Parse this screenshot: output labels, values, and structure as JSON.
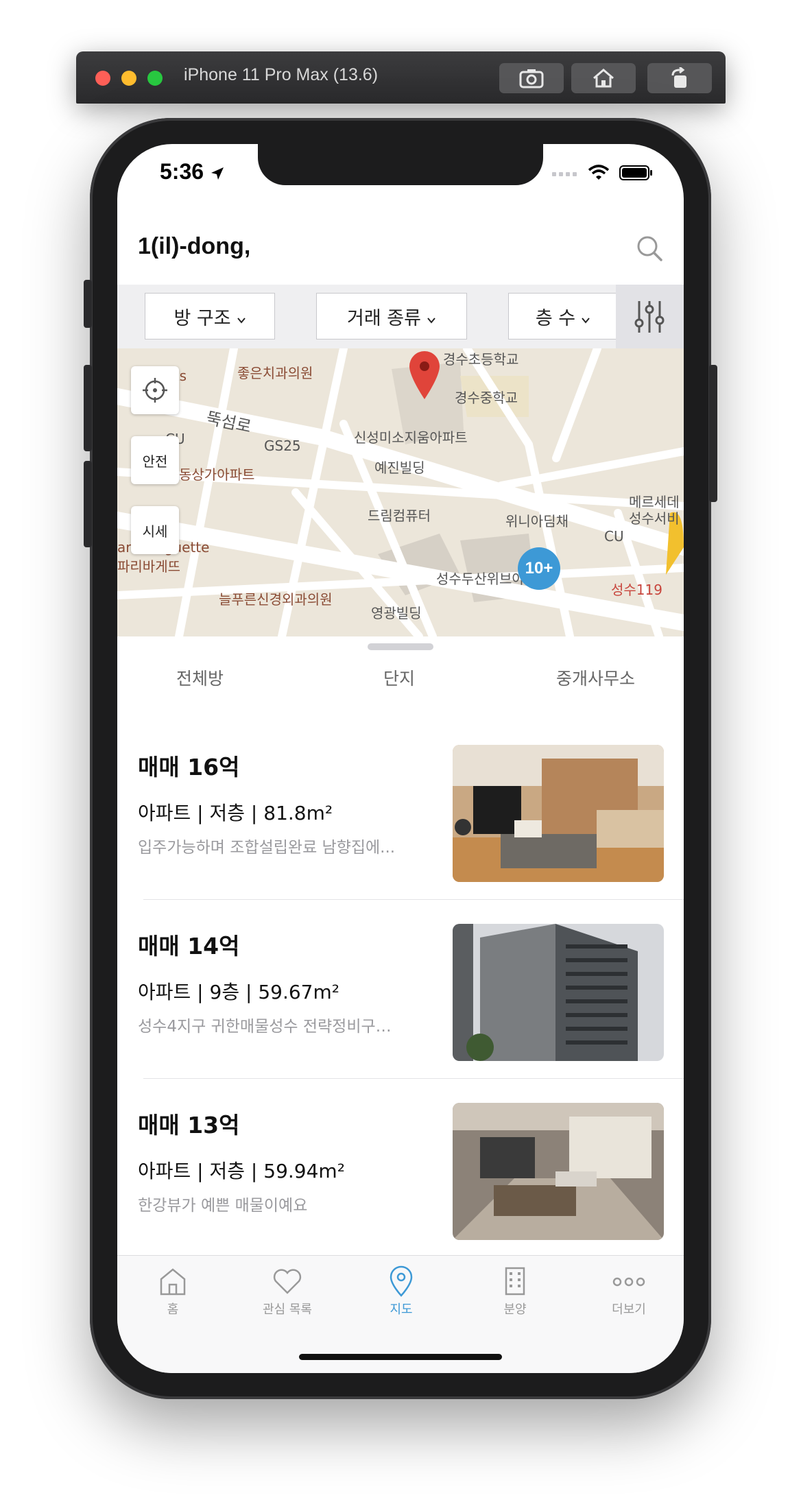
{
  "simulator": {
    "title": "iPhone 11 Pro Max (13.6)",
    "buttons": [
      "screenshot-icon",
      "home-icon",
      "rotate-icon"
    ]
  },
  "status_bar": {
    "time": "5:36",
    "icons": [
      "location-arrow-icon",
      "signal-icon",
      "wifi-icon",
      "battery-icon"
    ]
  },
  "header": {
    "address": "1(il)-dong,",
    "search_icon": "search-icon"
  },
  "filters": {
    "items": [
      {
        "label": "방 구조"
      },
      {
        "label": "거래 종류"
      },
      {
        "label": "층 수"
      }
    ],
    "settings_icon": "sliders-icon"
  },
  "map": {
    "controls": {
      "locate_icon": "crosshair-icon",
      "safety": "안전",
      "price": "시세"
    },
    "labels": {
      "clinic": "좋은치과의원",
      "school_elem": "경수초등학교",
      "school_mid": "경수중학교",
      "ttukseom": "뚝섬로",
      "gs25": "GS25",
      "cu1": "CU",
      "apt1": "신성미소지움아파트",
      "bldg1": "예진빌딩",
      "shops": "동상가아파트",
      "dream": "드림컴퓨터",
      "winia": "위니아딤채",
      "mercedes": "메르세데",
      "mercedes2": "성수서비",
      "cu2": "CU",
      "paris_en": "aris Baguette",
      "paris_ko": "파리바게뜨",
      "starbucks": "cks",
      "starbucks2": "스",
      "doosan": "성수두산위브아파트",
      "fire": "성수119",
      "surgery": "늘푸른신경외과의원",
      "younggwang": "영광빌딩"
    },
    "cluster": "10+"
  },
  "sheet_tabs": [
    "전체방",
    "단지",
    "중개사무소"
  ],
  "listings": [
    {
      "price": "매매 16억",
      "meta": "아파트 | 저층 | 81.8m²",
      "desc": "입주가능하며 조합설립완료 남향집에..."
    },
    {
      "price": "매매 14억",
      "meta": "아파트 | 9층 | 59.67m²",
      "desc": "성수4지구 귀한매물성수 전략정비구…"
    },
    {
      "price": "매매 13억",
      "meta": "아파트 | 저층 | 59.94m²",
      "desc": "한강뷰가 예쁜 매물이예요"
    }
  ],
  "tabbar": {
    "items": [
      {
        "label": "홈",
        "icon": "home-icon"
      },
      {
        "label": "관심 목록",
        "icon": "heart-icon"
      },
      {
        "label": "지도",
        "icon": "map-pin-icon"
      },
      {
        "label": "분양",
        "icon": "building-icon"
      },
      {
        "label": "더보기",
        "icon": "more-icon"
      }
    ],
    "active": "지도"
  },
  "colors": {
    "accent": "#3d99d6",
    "pin": "#e0443a",
    "map_bg": "#ece6da"
  }
}
